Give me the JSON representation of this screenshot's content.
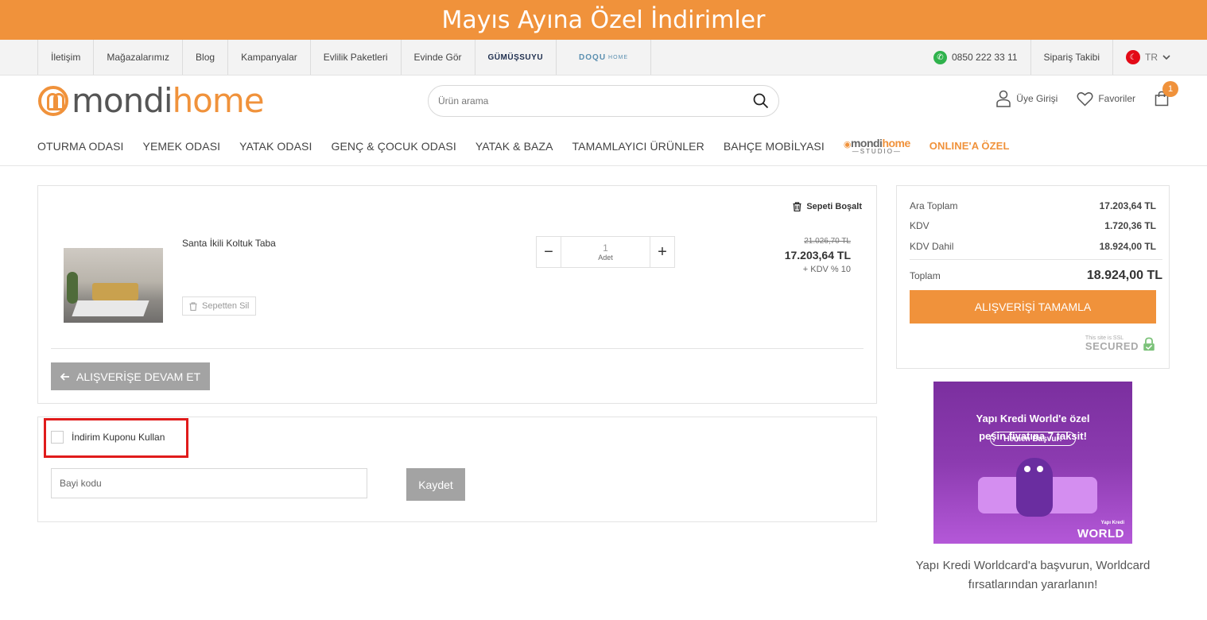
{
  "promo": {
    "text": "Mayıs Ayına Özel İndirimler"
  },
  "topbar": {
    "links": [
      "İletişim",
      "Mağazalarımız",
      "Blog",
      "Kampanyalar",
      "Evlilik Paketleri",
      "Evinde Gör"
    ],
    "brand_gumussuyu": "GÜMÜŞSUYU",
    "brand_doqu": "DOQU",
    "brand_doqu_sub": "HOME",
    "phone": "0850 222 33 11",
    "order_tracking": "Sipariş Takibi",
    "language": "TR"
  },
  "header": {
    "logo_part1": "mondi",
    "logo_part2": "home",
    "search_placeholder": "Ürün arama",
    "login": "Üye Girişi",
    "favorites": "Favoriler",
    "cart_count": "1"
  },
  "nav": {
    "items": [
      "OTURMA ODASI",
      "YEMEK ODASI",
      "YATAK ODASI",
      "GENÇ & ÇOCUK ODASI",
      "YATAK & BAZA",
      "TAMAMLAYICI ÜRÜNLER",
      "BAHÇE MOBİLYASI"
    ],
    "studio_part1": "mondi",
    "studio_part2": "home",
    "studio_sub": "—STUDIO—",
    "online": "ONLINE'A ÖZEL"
  },
  "cart": {
    "clear_label": "Sepeti Boşalt",
    "product_name": "Santa İkili Koltuk Taba",
    "remove_label": "Sepetten Sil",
    "quantity": "1",
    "quantity_unit": "Adet",
    "old_price": "21.026,70 TL",
    "price": "17.203,64 TL",
    "vat_note": "+ KDV % 10",
    "continue_label": "ALIŞVERİŞE DEVAM ET"
  },
  "coupon": {
    "label": "İndirim Kuponu Kullan",
    "dealer_placeholder": "Bayi kodu",
    "save_label": "Kaydet"
  },
  "summary": {
    "subtotal_label": "Ara Toplam",
    "subtotal_value": "17.203,64 TL",
    "vat_label": "KDV",
    "vat_value": "1.720,36 TL",
    "incl_vat_label": "KDV Dahil",
    "incl_vat_value": "18.924,00 TL",
    "total_label": "Toplam",
    "total_value": "18.924,00 TL",
    "checkout_label": "ALIŞVERİŞİ TAMAMLA",
    "ssl_small": "This site is SSL",
    "ssl_big": "SECURED"
  },
  "banner": {
    "line1": "Yapı Kredi World'e özel",
    "line2": "peşin fiyatına 7 taksit!",
    "button": "Hemen Başvur!",
    "world_small": "Yapı Kredi",
    "world": "WORLD",
    "caption": "Yapı Kredi Worldcard'a başvurun, Worldcard fırsatlarından yararlanın!"
  },
  "colors": {
    "accent": "#f0923b",
    "gray_button": "#a3a3a3",
    "highlight": "#e01b1b"
  }
}
